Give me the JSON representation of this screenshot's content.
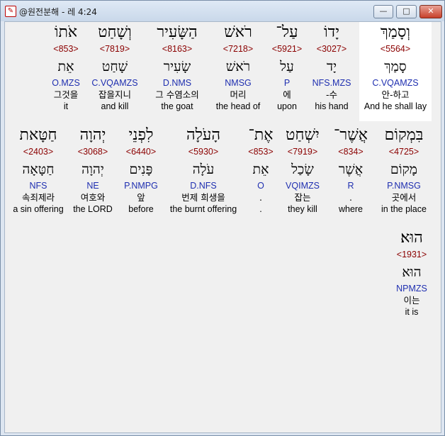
{
  "window": {
    "title": "@원전분해 - 레 4:24",
    "app_icon_glyph": "✎",
    "minimize_glyph": "—",
    "maximize_glyph": "□",
    "close_glyph": "✕"
  },
  "row1": [
    {
      "hebrew": "וְסָמַךְ",
      "strong": "<5564>",
      "lemma": "סָמַךְ",
      "morph": "C.VQAMZS",
      "korean": "안-하고",
      "english": "And he shall lay",
      "selected": true
    },
    {
      "hebrew": "יָדוֹ",
      "strong": "<3027>",
      "lemma": "יָד",
      "morph": "NFS.MZS",
      "korean": "-수",
      "english": "his hand"
    },
    {
      "hebrew": "עַל־",
      "strong": "<5921>",
      "lemma": "עַל",
      "morph": "P",
      "korean": "에",
      "english": "upon"
    },
    {
      "hebrew": "רֹאשׁ",
      "strong": "<7218>",
      "lemma": "רֹאשׁ",
      "morph": "NMSG",
      "korean": "머리",
      "english": "the head of"
    },
    {
      "hebrew": "הַשָּׂעִיר",
      "strong": "<8163>",
      "lemma": "שָׂעִיר",
      "morph": "D.NMS",
      "korean": "그 수염소의",
      "english": "the goat"
    },
    {
      "hebrew": "וְשָׁחַט",
      "strong": "<7819>",
      "lemma": "שָׁחַט",
      "morph": "C.VQAMZS",
      "korean": "잡을지니",
      "english": "and kill"
    },
    {
      "hebrew": "אֹתוֹ",
      "strong": "<853>",
      "lemma": "אֵת",
      "morph": "O.MZS",
      "korean": "그것을",
      "english": "it"
    }
  ],
  "row2": [
    {
      "hebrew": "בִּמְקוֹם",
      "strong": "<4725>",
      "lemma": "מָקוֹם",
      "morph": "P.NMSG",
      "korean": "곳에서",
      "english": "in the place"
    },
    {
      "hebrew": "אֲשֶׁר־",
      "strong": "<834>",
      "lemma": "אֲשֶׁר",
      "morph": "R",
      "korean": ".",
      "english": "where"
    },
    {
      "hebrew": "יִשְׁחַט",
      "strong": "<7919>",
      "lemma": "שָׂכַל",
      "morph": "VQIMZS",
      "korean": "잡는",
      "english": "they kill"
    },
    {
      "hebrew": "אֶת־",
      "strong": "<853>",
      "lemma": "אֵת",
      "morph": "O",
      "korean": ".",
      "english": "."
    },
    {
      "hebrew": "הָעֹלָה",
      "strong": "<5930>",
      "lemma": "עֹלָה",
      "morph": "D.NFS",
      "korean": "번제 희생을",
      "english": "the burnt offering"
    },
    {
      "hebrew": "לִפְנֵי",
      "strong": "<6440>",
      "lemma": "פָּנִים",
      "morph": "P.NMPG",
      "korean": "앞",
      "english": "before"
    },
    {
      "hebrew": "יְהוָה",
      "strong": "<3068>",
      "lemma": "יְהוָה",
      "morph": "NE",
      "korean": "여호와",
      "english": "the LORD"
    },
    {
      "hebrew": "חַטָּאת",
      "strong": "<2403>",
      "lemma": "חַטָּאָה",
      "morph": "NFS",
      "korean": "속죄제라",
      "english": "a sin offering"
    }
  ],
  "row3": [
    {
      "hebrew": "הוּא׃",
      "strong": "<1931>",
      "lemma": "הוּא",
      "morph": "NPMZS",
      "korean": "이는",
      "english": "it is"
    }
  ]
}
